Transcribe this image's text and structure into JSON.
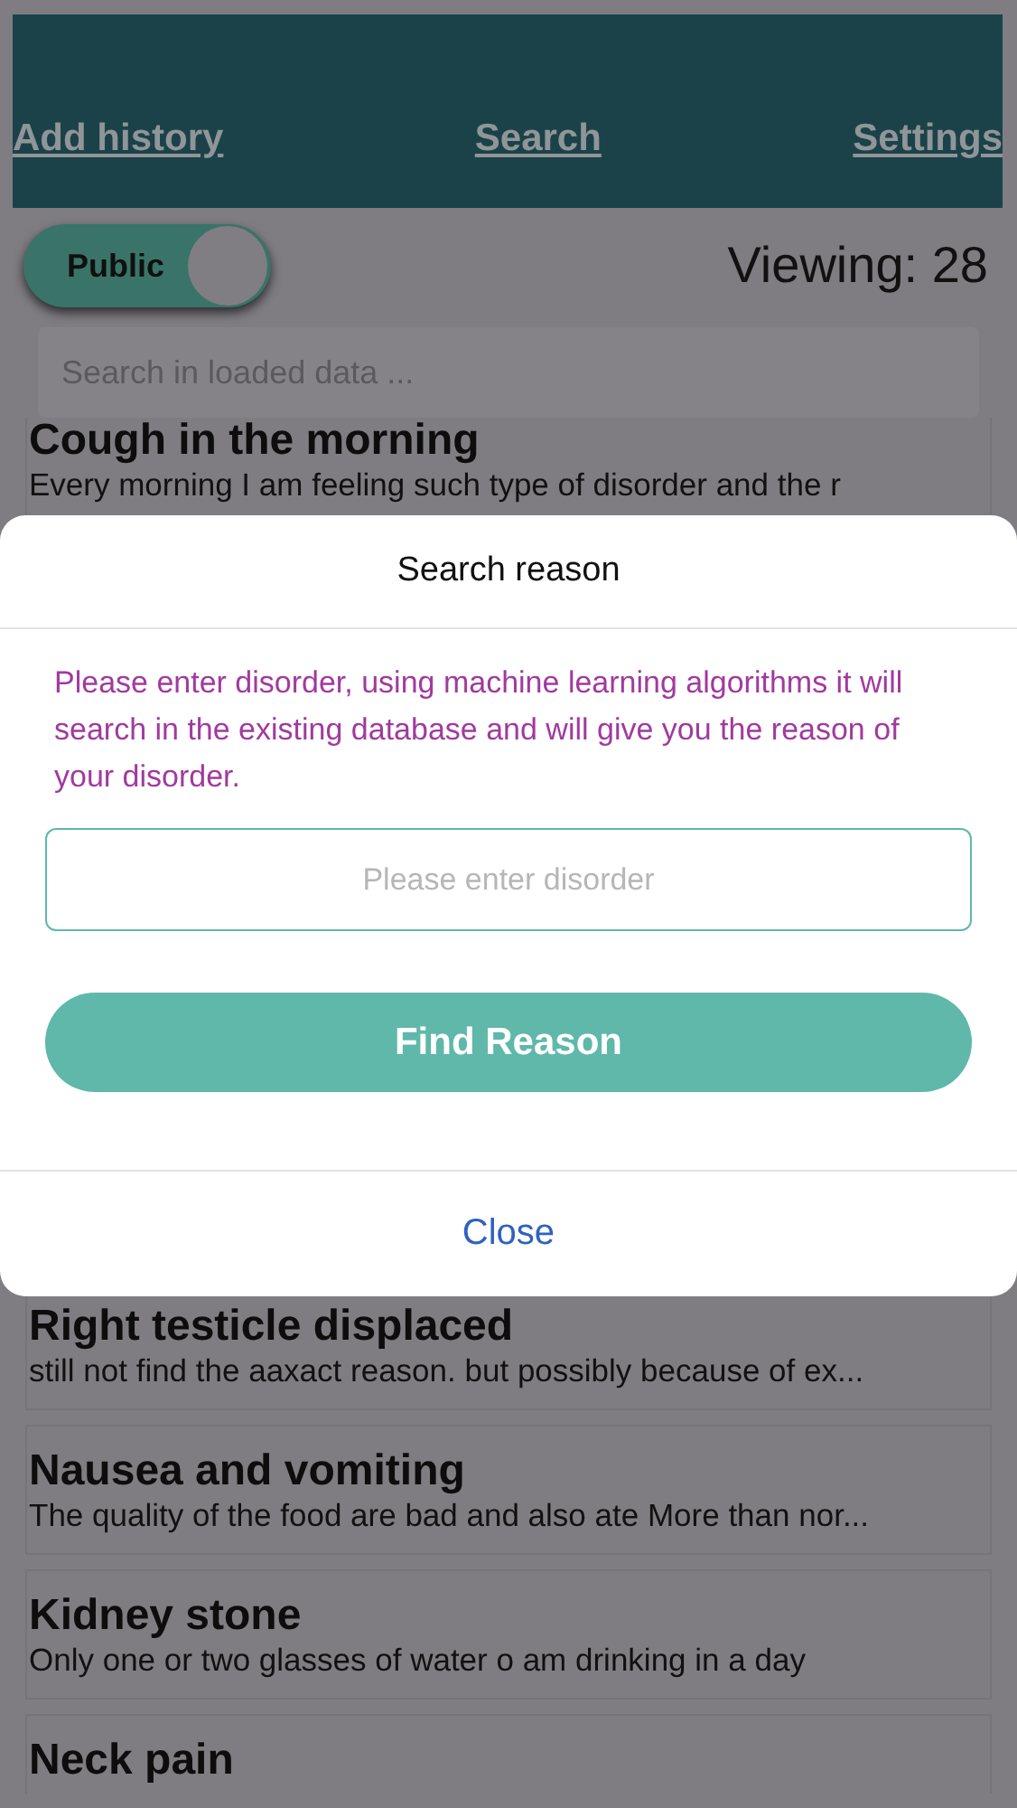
{
  "nav": [
    {
      "label": "Add history"
    },
    {
      "label": "Search"
    },
    {
      "label": "Settings"
    }
  ],
  "visibility_toggle": {
    "label": "Public",
    "on": true
  },
  "viewing": "Viewing: 28",
  "search": {
    "placeholder": "Search in loaded data ..."
  },
  "entries": [
    {
      "title": "Cough in the morning",
      "description": "Every morning I am feeling such type of disorder and the r"
    },
    {
      "title": "Right testicle displaced",
      "description": "still not find the aaxact reason. but possibly because of ex..."
    },
    {
      "title": "Nausea and vomiting",
      "description": "The quality of the food are bad and also ate More than nor..."
    },
    {
      "title": "Kidney stone",
      "description": "Only one or two glasses of water o am drinking in a day"
    },
    {
      "title": "Neck pain"
    }
  ],
  "dialog": {
    "title": "Search reason",
    "message": "Please enter disorder, using machine learning algorithms it will search in the existing database and will give you the reason of your disorder.",
    "input": {
      "placeholder": "Please enter disorder"
    },
    "submit": "Find Reason",
    "close": "Close"
  }
}
